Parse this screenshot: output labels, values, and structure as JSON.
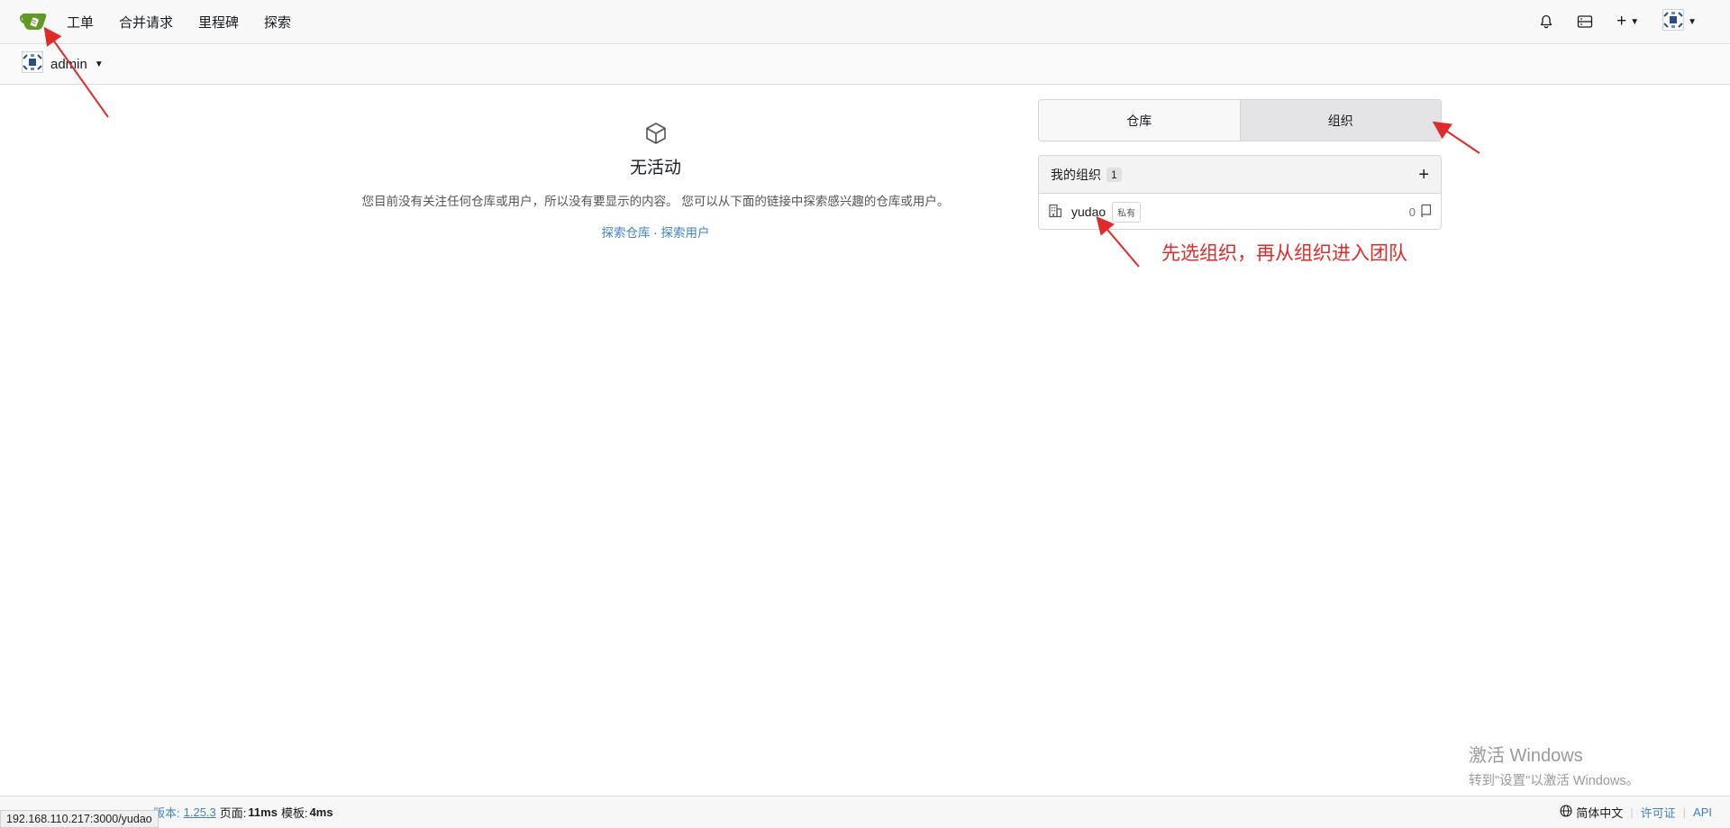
{
  "nav": {
    "items": [
      {
        "label": "工单"
      },
      {
        "label": "合并请求"
      },
      {
        "label": "里程碑"
      },
      {
        "label": "探索"
      }
    ],
    "plus_label": "+"
  },
  "context": {
    "user": "admin"
  },
  "feed": {
    "empty_title": "无活动",
    "empty_desc": "您目前没有关注任何仓库或用户，所以没有要显示的内容。 您可以从下面的链接中探索感兴趣的仓库或用户。",
    "explore_repos": "探索仓库",
    "link_sep": "·",
    "explore_users": "探索用户"
  },
  "dashboard": {
    "tabs": [
      {
        "label": "仓库"
      },
      {
        "label": "组织"
      }
    ],
    "active_tab": "组织",
    "org_panel": {
      "title": "我的组织",
      "count": "1",
      "add": "+",
      "orgs": [
        {
          "name": "yudao",
          "badge": "私有",
          "repo_count": "0"
        }
      ]
    }
  },
  "annotation": {
    "text": "先选组织，再从组织进入团队",
    "color": "#e02a2a"
  },
  "watermark": {
    "line1": "激活 Windows",
    "line2": "转到\"设置\"以激活 Windows。"
  },
  "footer": {
    "version_prefix": "版本:",
    "version": "1.25.3",
    "page_label": "页面:",
    "page_time": "11ms",
    "template_label": "模板:",
    "template_time": "4ms",
    "status_url": "192.168.110.217:3000/yudao",
    "language": "简体中文",
    "license": "许可证",
    "api": "API"
  },
  "colors": {
    "link": "#4183c4",
    "logo_green": "#609926"
  }
}
